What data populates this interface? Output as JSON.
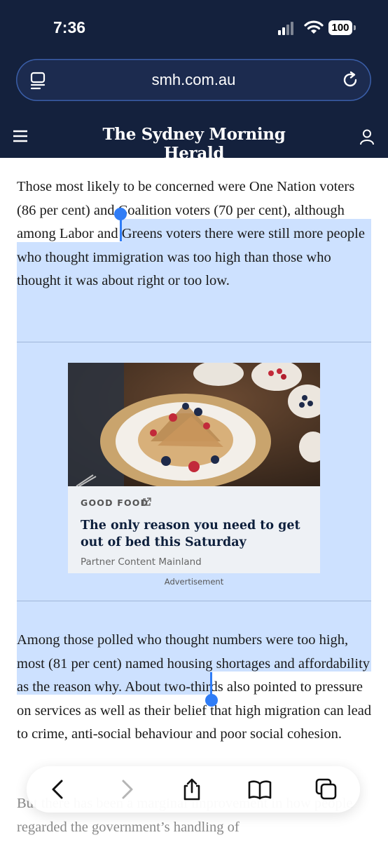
{
  "status_bar": {
    "time": "7:36",
    "battery": "100"
  },
  "browser": {
    "url": "smh.com.au"
  },
  "site": {
    "masthead": "The Sydney Morning Herald"
  },
  "article": {
    "paragraph_1": "Those most likely to be concerned were One Nation voters (86 per cent) and Coalition voters (70 per cent), although among Labor and Greens voters there were still more people who thought immigration was too high than those who thought it was about right or too low.",
    "paragraph_2": "Among those polled who thought numbers were too high, most (81 per cent) named housing shortages and affordability as the reason why. About two-thirds also pointed to pressure on services as well as their belief that high migration can lead to crime, anti-social behaviour and poor social cohesion.",
    "paragraph_3": "But there has been a marginal improvement in how people regarded the government’s handling of"
  },
  "ad": {
    "source": "GOOD FOOD",
    "headline": "The only reason you need to get out of bed this Saturday",
    "partner": "Partner Content Mainland",
    "label": "Advertisement"
  },
  "colors": {
    "chrome_bg": "#14213d",
    "selection": "#4d94ff",
    "handle": "#2f7cf6"
  },
  "icons": [
    "tabs-icon",
    "reload-icon",
    "menu-icon",
    "account-icon",
    "external-link-icon",
    "back-icon",
    "forward-icon",
    "share-icon",
    "bookmarks-icon",
    "tabs-overview-icon"
  ]
}
